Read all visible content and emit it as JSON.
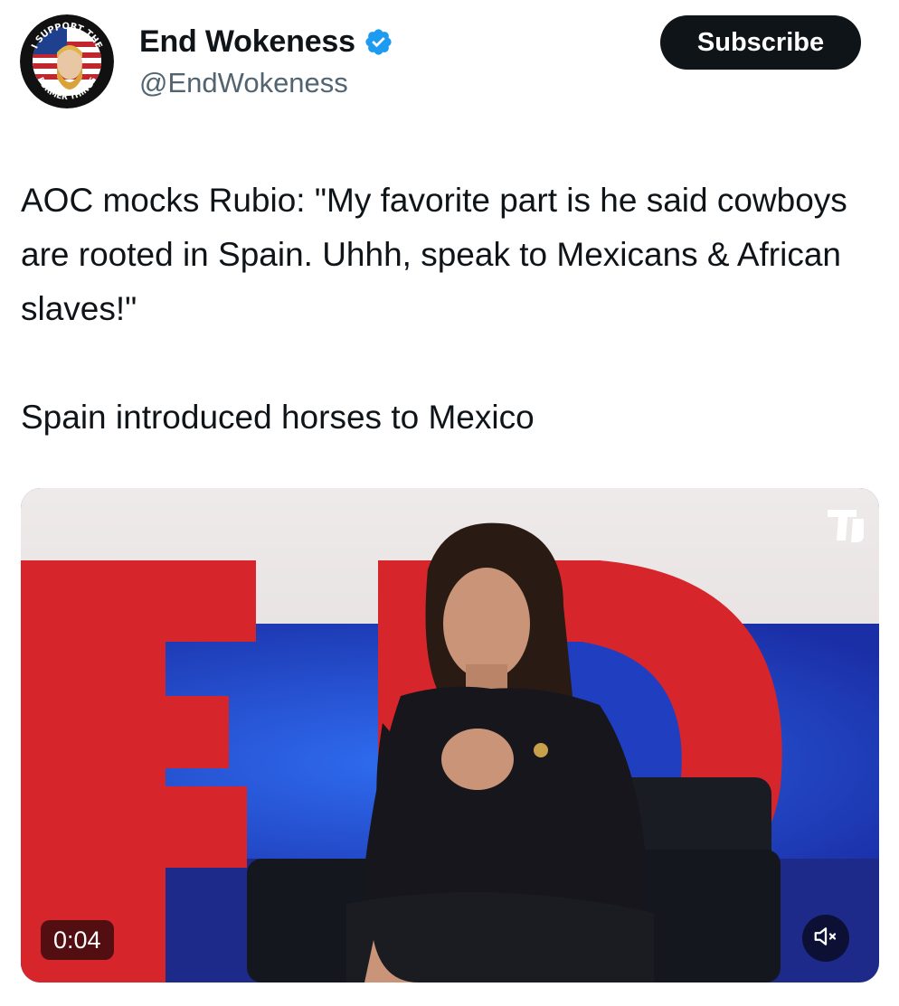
{
  "post": {
    "author": {
      "display_name": "End Wokeness",
      "handle": "@EndWokeness",
      "verified": true,
      "avatar_icon": "support-former-things-avatar-icon",
      "avatar_text_top": "I SUPPORT THE",
      "avatar_text_bottom": "FORMER THINGS"
    },
    "subscribe_label": "Subscribe",
    "text_paragraph_1": "AOC mocks Rubio: \"My favorite part is he said cowboys are rooted in Spain. Uhhh, speak to Mexicans & African slaves!\"",
    "text_paragraph_2": "Spain introduced horses to Mexico",
    "video": {
      "timestamp": "0:04",
      "muted": true,
      "mute_icon": "speaker-muted-icon",
      "watermark_icon": "channel-logo-icon"
    }
  },
  "colors": {
    "text_primary": "#0f1419",
    "text_secondary": "#536471",
    "verified_blue": "#1d9bf0",
    "button_bg": "#0f1419",
    "button_text": "#ffffff"
  }
}
